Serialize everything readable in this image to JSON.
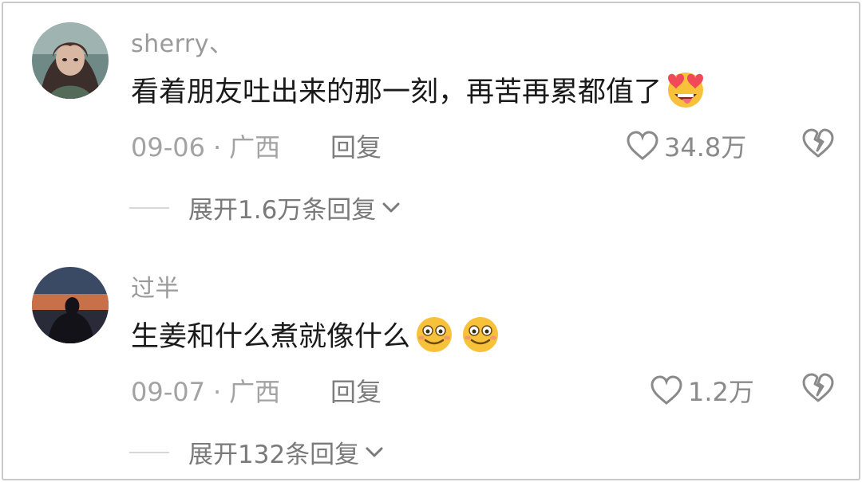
{
  "comments": [
    {
      "username": "sherry、",
      "text": "看着朋友吐出来的那一刻，再苦再累都值了",
      "emoji": "heart-eyes-tongue-emoji",
      "date": "09-06",
      "separator": "·",
      "location": "广西",
      "reply_label": "回复",
      "likes": "34.8万",
      "expand_label": "展开1.6万条回复"
    },
    {
      "username": "过半",
      "text": "生姜和什么煮就像什么",
      "emoji": "smile-emoji",
      "date": "09-07",
      "separator": "·",
      "location": "广西",
      "reply_label": "回复",
      "likes": "1.2万",
      "expand_label": "展开132条回复"
    }
  ],
  "colors": {
    "username": "#9a9a9a",
    "text": "#1a1a1a",
    "meta": "#a3a3a3",
    "reply": "#7d7d7d",
    "emoji_yellow": "#f7c23a"
  }
}
